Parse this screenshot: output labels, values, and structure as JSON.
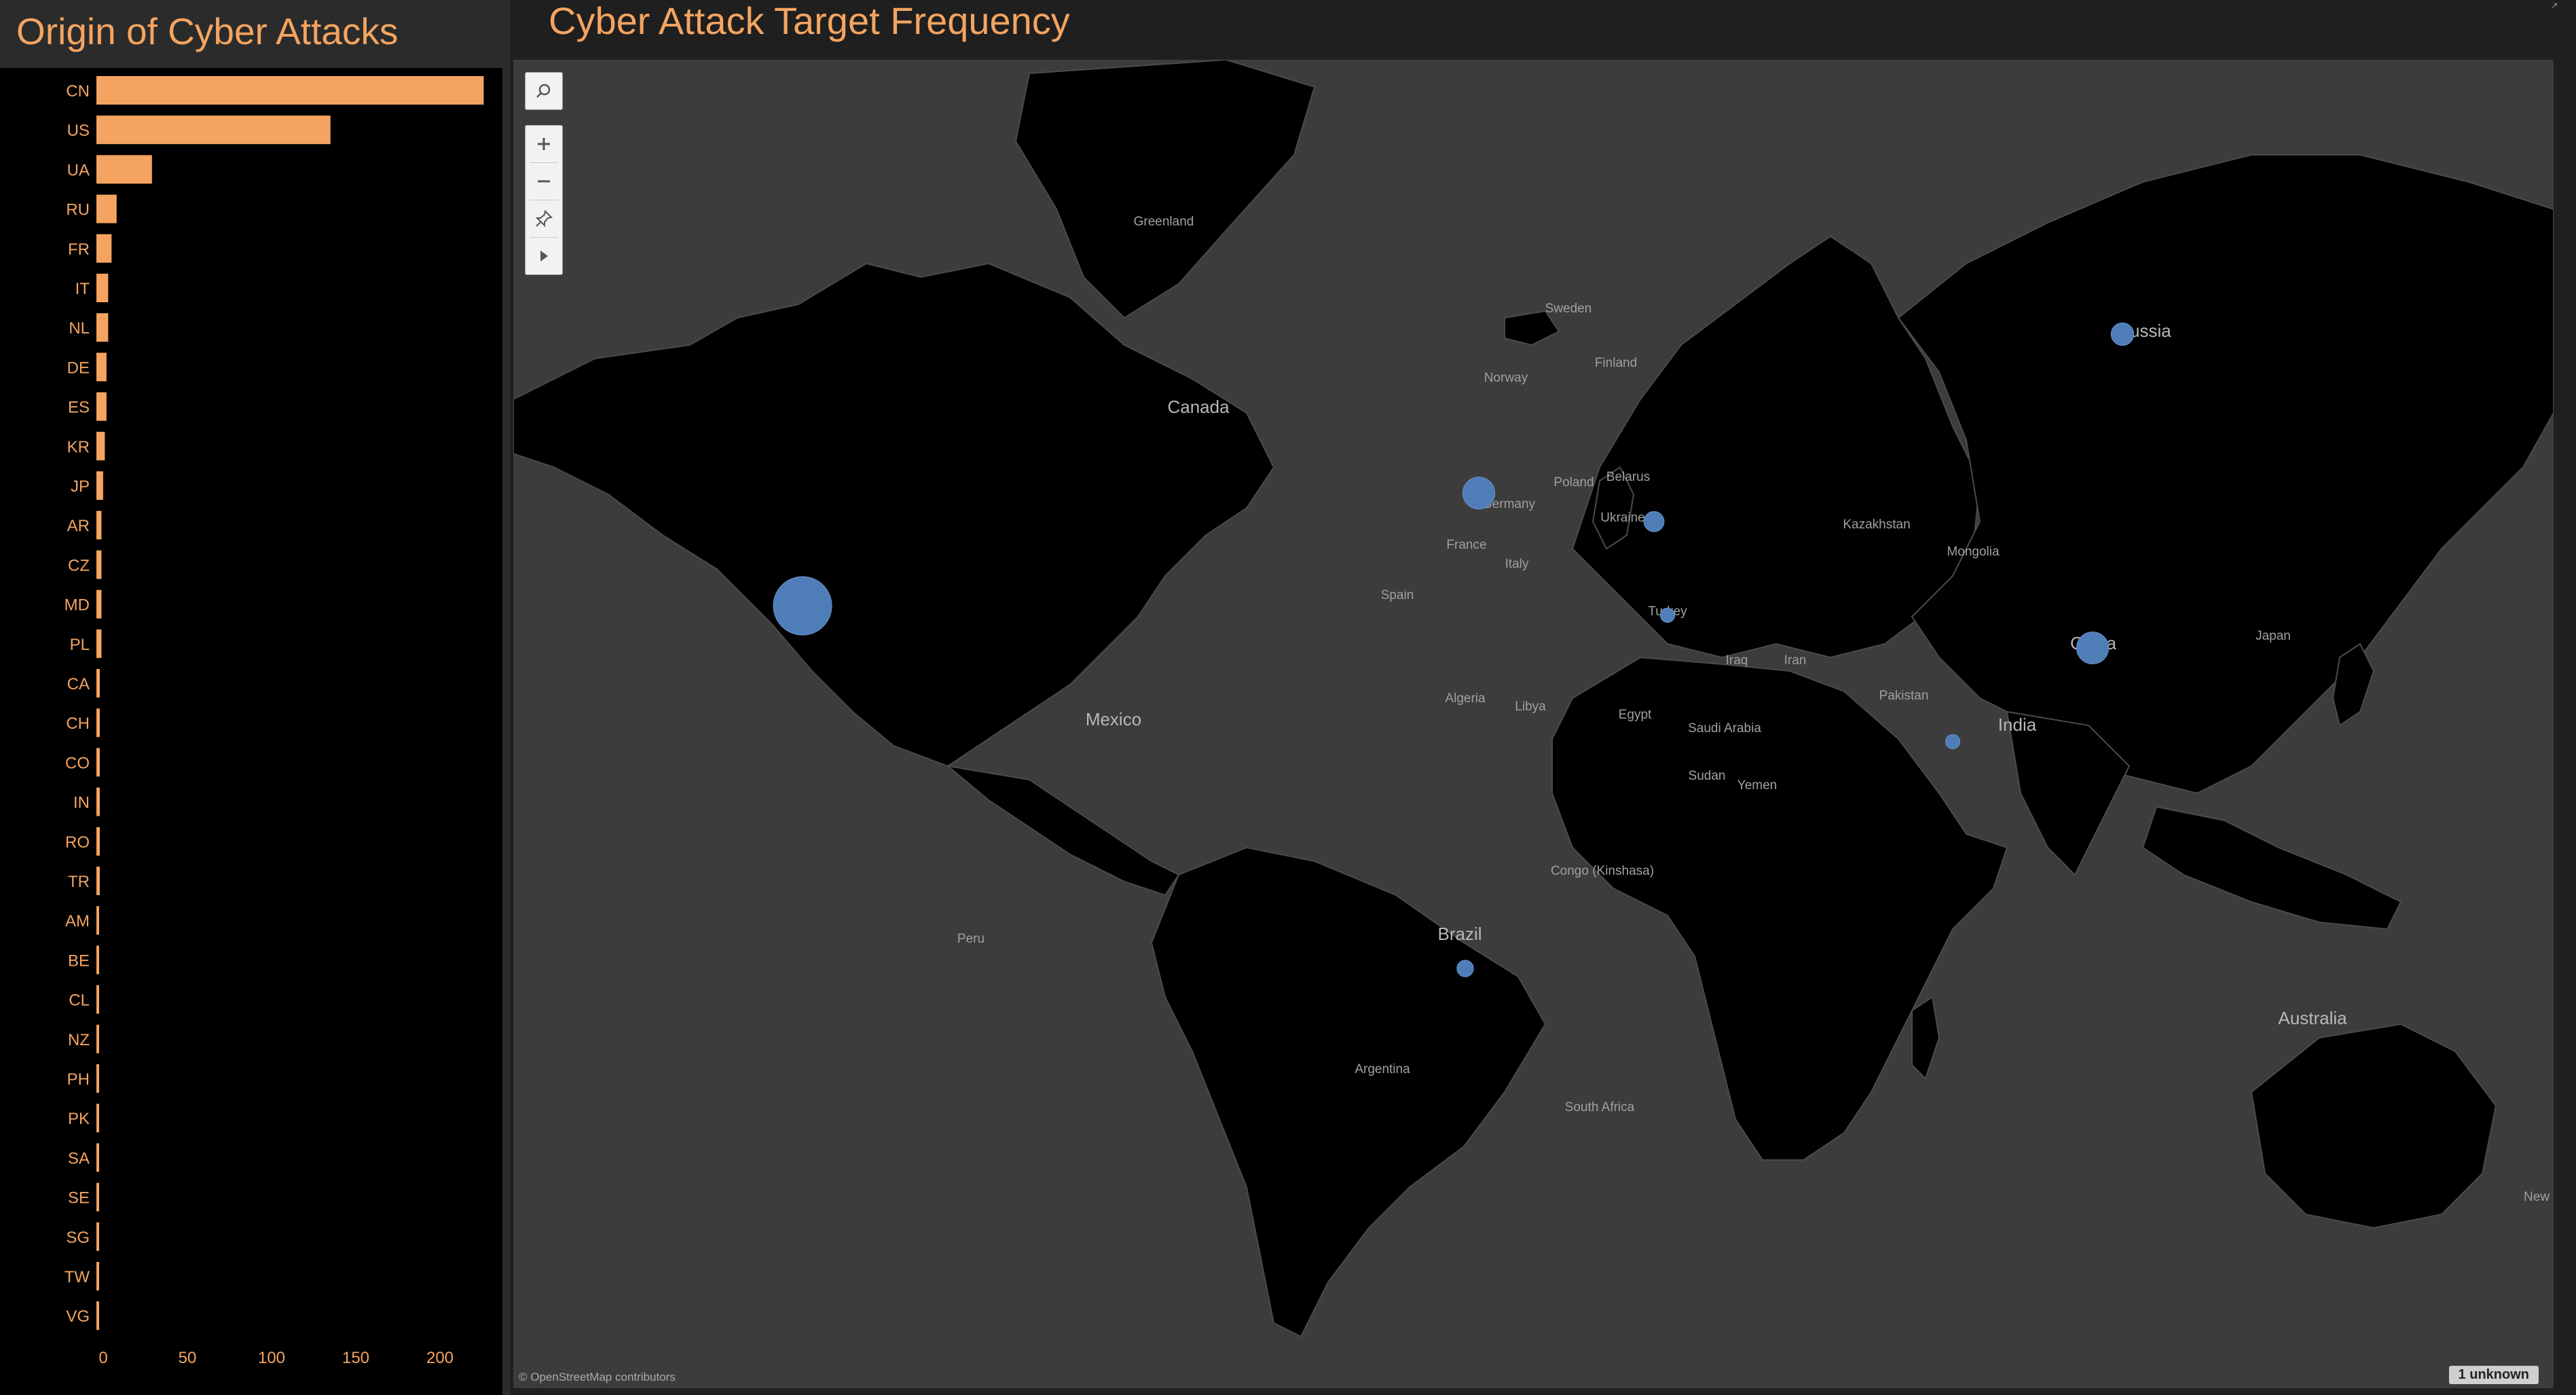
{
  "left_title": "Origin of Cyber Attacks",
  "right_title": "Cyber Attack Target Frequency",
  "colors": {
    "bar": "#f4a460",
    "bubble": "#4f7db8",
    "land": "#000000",
    "water": "#3c3c3c"
  },
  "chart_data": {
    "type": "bar",
    "orientation": "horizontal",
    "title": "Origin of Cyber Attacks",
    "categories": [
      "CN",
      "US",
      "UA",
      "RU",
      "FR",
      "IT",
      "NL",
      "DE",
      "ES",
      "KR",
      "JP",
      "AR",
      "CZ",
      "MD",
      "PL",
      "CA",
      "CH",
      "CO",
      "IN",
      "RO",
      "TR",
      "AM",
      "BE",
      "CL",
      "NZ",
      "PH",
      "PK",
      "SA",
      "SE",
      "SG",
      "TW",
      "VG"
    ],
    "values": [
      230,
      139,
      33,
      12,
      9,
      7,
      7,
      6,
      6,
      5,
      4,
      3,
      3,
      3,
      3,
      2,
      2,
      2,
      2,
      2,
      2,
      1,
      1,
      1,
      1,
      1,
      1,
      1,
      1,
      1,
      1,
      1
    ],
    "xticks": [
      "0",
      "50",
      "100",
      "150",
      "200"
    ],
    "xlim": [
      0,
      240
    ]
  },
  "map": {
    "icons": [
      "search-icon",
      "zoom-in-icon",
      "zoom-out-icon",
      "pin-icon",
      "play-icon"
    ],
    "attribution": "© OpenStreetMap contributors",
    "unknown_badge": "1 unknown",
    "labels": [
      "Greenland",
      "Canada",
      "Sweden",
      "Finland",
      "Norway",
      "Russia",
      "Poland",
      "Belarus",
      "Germany",
      "Ukraine",
      "France",
      "Italy",
      "Spain",
      "Kazakhstan",
      "Mongolia",
      "Turkey",
      "Iraq",
      "Iran",
      "China",
      "Japan",
      "Algeria",
      "Libya",
      "Egypt",
      "Saudi Arabia",
      "Pakistan",
      "India",
      "Mexico",
      "Sudan",
      "Yemen",
      "Congo (Kinshasa)",
      "Brazil",
      "Peru",
      "Argentina",
      "South Africa",
      "Australia",
      "New"
    ],
    "bubbles": [
      {
        "country": "US",
        "level": 1.0
      },
      {
        "country": "DE",
        "level": 0.3
      },
      {
        "country": "CN",
        "level": 0.3
      },
      {
        "country": "RU",
        "level": 0.15
      },
      {
        "country": "UA",
        "level": 0.12
      },
      {
        "country": "BR",
        "level": 0.08
      },
      {
        "country": "TR",
        "level": 0.06
      },
      {
        "country": "IN",
        "level": 0.06
      }
    ]
  }
}
